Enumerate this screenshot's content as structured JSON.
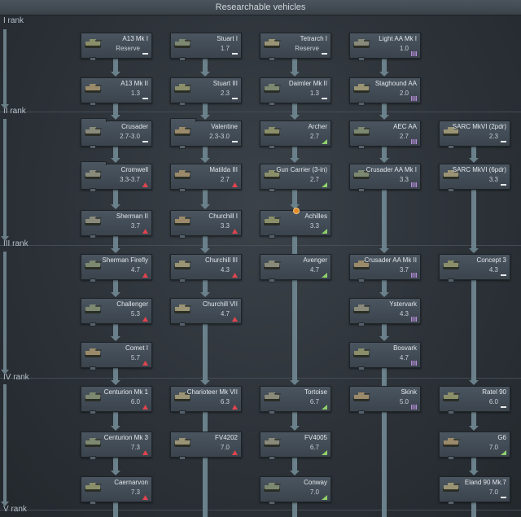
{
  "header": {
    "title": "Researchable vehicles"
  },
  "ranks": [
    "I rank",
    "II rank",
    "III rank",
    "IV rank",
    "V rank"
  ],
  "colors": {
    "reserve": "#e8eaec",
    "premium_tree": "#b58bd8",
    "event": "#e0444d",
    "green": "#8fd16b",
    "flag_grey": "#c8cdd2"
  },
  "vehicles": [
    {
      "name": "A13 Mk I",
      "br": "Reserve",
      "badge": "reserve"
    },
    {
      "name": "Stuart I",
      "br": "1.7",
      "badge": "reserve"
    },
    {
      "name": "Tetrarch I",
      "br": "Reserve",
      "badge": "reserve"
    },
    {
      "name": "Light AA Mk I",
      "br": "1.0",
      "badge": "premium"
    },
    {
      "name": "A13 Mk II",
      "br": "1.3",
      "badge": "reserve"
    },
    {
      "name": "Stuart III",
      "br": "2.3",
      "badge": "reserve"
    },
    {
      "name": "Daimler Mk II",
      "br": "1.3",
      "badge": "reserve"
    },
    {
      "name": "Staghound AA",
      "br": "2.0",
      "badge": "premium"
    },
    {
      "name": "Crusader",
      "br": "2.7-3.0",
      "badge": "reserve"
    },
    {
      "name": "Valentine",
      "br": "2.3-3.0",
      "badge": "reserve"
    },
    {
      "name": "Archer",
      "br": "2.7",
      "badge": "green"
    },
    {
      "name": "AEC AA",
      "br": "2.7",
      "badge": "premium"
    },
    {
      "name": "SARC MkVI (2pdr)",
      "br": "2.3",
      "badge": "reserve"
    },
    {
      "name": "Cromwell",
      "br": "3.3-3.7",
      "badge": "event"
    },
    {
      "name": "Matilda III",
      "br": "2.7",
      "badge": "event"
    },
    {
      "name": "Gun Carrier (3-in)",
      "br": "2.7",
      "badge": "green"
    },
    {
      "name": "Crusader AA Mk I",
      "br": "3.3",
      "badge": "premium"
    },
    {
      "name": "SARC MkVI (6pdr)",
      "br": "3.3",
      "badge": "reserve"
    },
    {
      "name": "Sherman II",
      "br": "3.7",
      "badge": "event"
    },
    {
      "name": "Churchill I",
      "br": "3.3",
      "badge": "event"
    },
    {
      "name": "Achilles",
      "br": "3.3",
      "badge": "green"
    },
    {
      "name": "Sherman Firefly",
      "br": "4.7",
      "badge": "event"
    },
    {
      "name": "Churchill III",
      "br": "4.3",
      "badge": "event"
    },
    {
      "name": "Avenger",
      "br": "4.7",
      "badge": "green"
    },
    {
      "name": "Crusader AA Mk II",
      "br": "3.7",
      "badge": "premium"
    },
    {
      "name": "Concept 3",
      "br": "4.3",
      "badge": "reserve"
    },
    {
      "name": "Challenger",
      "br": "5.3",
      "badge": "event"
    },
    {
      "name": "Churchill VII",
      "br": "4.7",
      "badge": "event"
    },
    {
      "name": "Ystervark",
      "br": "4.3",
      "badge": "premium"
    },
    {
      "name": "Comet I",
      "br": "5.7",
      "badge": "event"
    },
    {
      "name": "Bosvark",
      "br": "4.7",
      "badge": "premium"
    },
    {
      "name": "Centurion Mk 1",
      "br": "6.0",
      "badge": "event"
    },
    {
      "name": "Charioteer Mk VII",
      "br": "6.3",
      "badge": "event"
    },
    {
      "name": "Tortoise",
      "br": "6.7",
      "badge": "green"
    },
    {
      "name": "Skink",
      "br": "5.0",
      "badge": "premium"
    },
    {
      "name": "Ratel 90",
      "br": "6.0",
      "badge": "reserve"
    },
    {
      "name": "Centurion Mk 3",
      "br": "7.3",
      "badge": "event"
    },
    {
      "name": "FV4202",
      "br": "7.0",
      "badge": "event"
    },
    {
      "name": "FV4005",
      "br": "6.7",
      "badge": "green"
    },
    {
      "name": "G6",
      "br": "7.0",
      "badge": "green"
    },
    {
      "name": "Caernarvon",
      "br": "7.3",
      "badge": "event"
    },
    {
      "name": "Conway",
      "br": "7.0",
      "badge": "green"
    },
    {
      "name": "Eland 90 Mk.7",
      "br": "7.0",
      "badge": "reserve"
    }
  ]
}
